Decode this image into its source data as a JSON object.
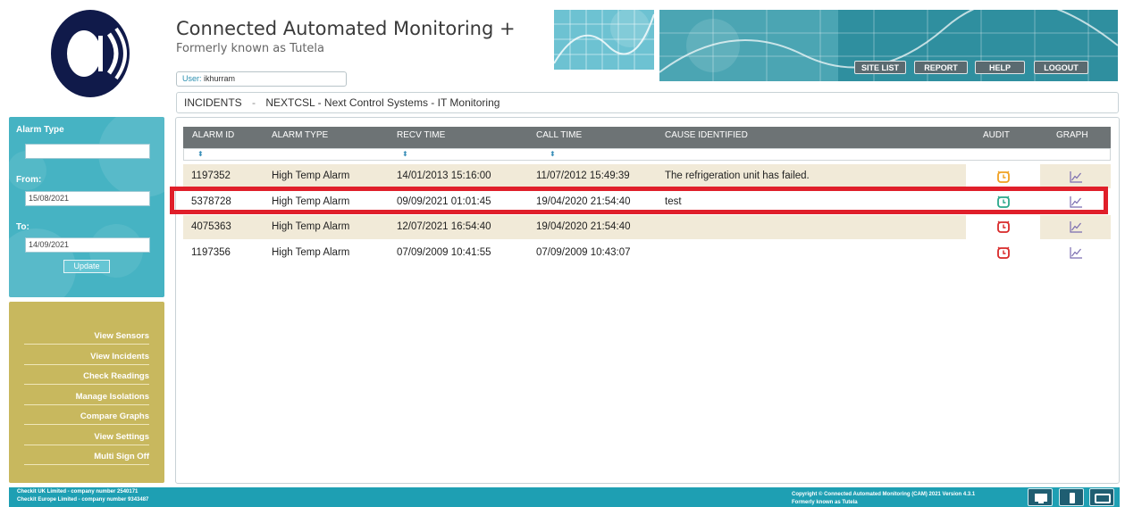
{
  "header": {
    "title": "Connected Automated Monitoring +",
    "subtitle": "Formerly known as Tutela",
    "user_label": "User:",
    "user_value": "ikhurram",
    "nav": {
      "site_list": "SITE LIST",
      "report": "REPORT",
      "help": "HELP",
      "logout": "LOGOUT"
    }
  },
  "breadcrumb": {
    "section": "INCIDENTS",
    "separator": "-",
    "site": "NEXTCSL - Next Control Systems - IT Monitoring"
  },
  "filter": {
    "alarm_type_label": "Alarm Type",
    "alarm_type_value": "",
    "from_label": "From:",
    "from_value": "15/08/2021",
    "to_label": "To:",
    "to_value": "14/09/2021",
    "update_label": "Update"
  },
  "menu": [
    "View Sensors",
    "View Incidents",
    "Check Readings",
    "Manage Isolations",
    "Compare Graphs",
    "View Settings",
    "Multi Sign Off"
  ],
  "table": {
    "columns": [
      "ALARM ID",
      "ALARM TYPE",
      "RECV TIME",
      "CALL TIME",
      "CAUSE IDENTIFIED",
      "AUDIT",
      "GRAPH"
    ],
    "sort_glyph": "⬍",
    "rows": [
      {
        "alarm_id": "1197352",
        "alarm_type": "High Temp Alarm",
        "recv_time": "14/01/2013 15:16:00",
        "call_time": "11/07/2012 15:49:39",
        "cause": "The refrigeration unit has failed.",
        "audit_status": "orange",
        "highlighted": false
      },
      {
        "alarm_id": "5378728",
        "alarm_type": "High Temp Alarm",
        "recv_time": "09/09/2021 01:01:45",
        "call_time": "19/04/2020 21:54:40",
        "cause": "test",
        "audit_status": "green",
        "highlighted": true
      },
      {
        "alarm_id": "4075363",
        "alarm_type": "High Temp Alarm",
        "recv_time": "12/07/2021 16:54:40",
        "call_time": "19/04/2020 21:54:40",
        "cause": "",
        "audit_status": "red",
        "highlighted": false
      },
      {
        "alarm_id": "1197356",
        "alarm_type": "High Temp Alarm",
        "recv_time": "07/09/2009 10:41:55",
        "call_time": "07/09/2009 10:43:07",
        "cause": "",
        "audit_status": "red",
        "highlighted": false
      }
    ]
  },
  "footer": {
    "left_line1": "Checkit UK Limited - company number 2540171",
    "left_line2": "Checkit Europe Limited - company number 9343487",
    "right_line1": "Copyright © Connected Automated Monitoring (CAM) 2021 Version 4.3.1",
    "right_line2": "Formerly known as Tutela"
  },
  "colors": {
    "accent_teal": "#1e9fb3",
    "filter_bg": "#46b3c3",
    "menu_bg": "#c8b85e",
    "table_header": "#6d7375",
    "row_tan": "#f1ead8",
    "highlight_red": "#e01f2a",
    "audit_orange": "#f0a020",
    "audit_green": "#2aa88a",
    "audit_red": "#d82828",
    "graph_purple": "#7a6cb0"
  },
  "icons": {
    "audit": "alarm-clock-icon",
    "graph": "line-chart-icon",
    "footer": [
      "desktop-icon",
      "mobile-icon",
      "tablet-icon"
    ]
  }
}
